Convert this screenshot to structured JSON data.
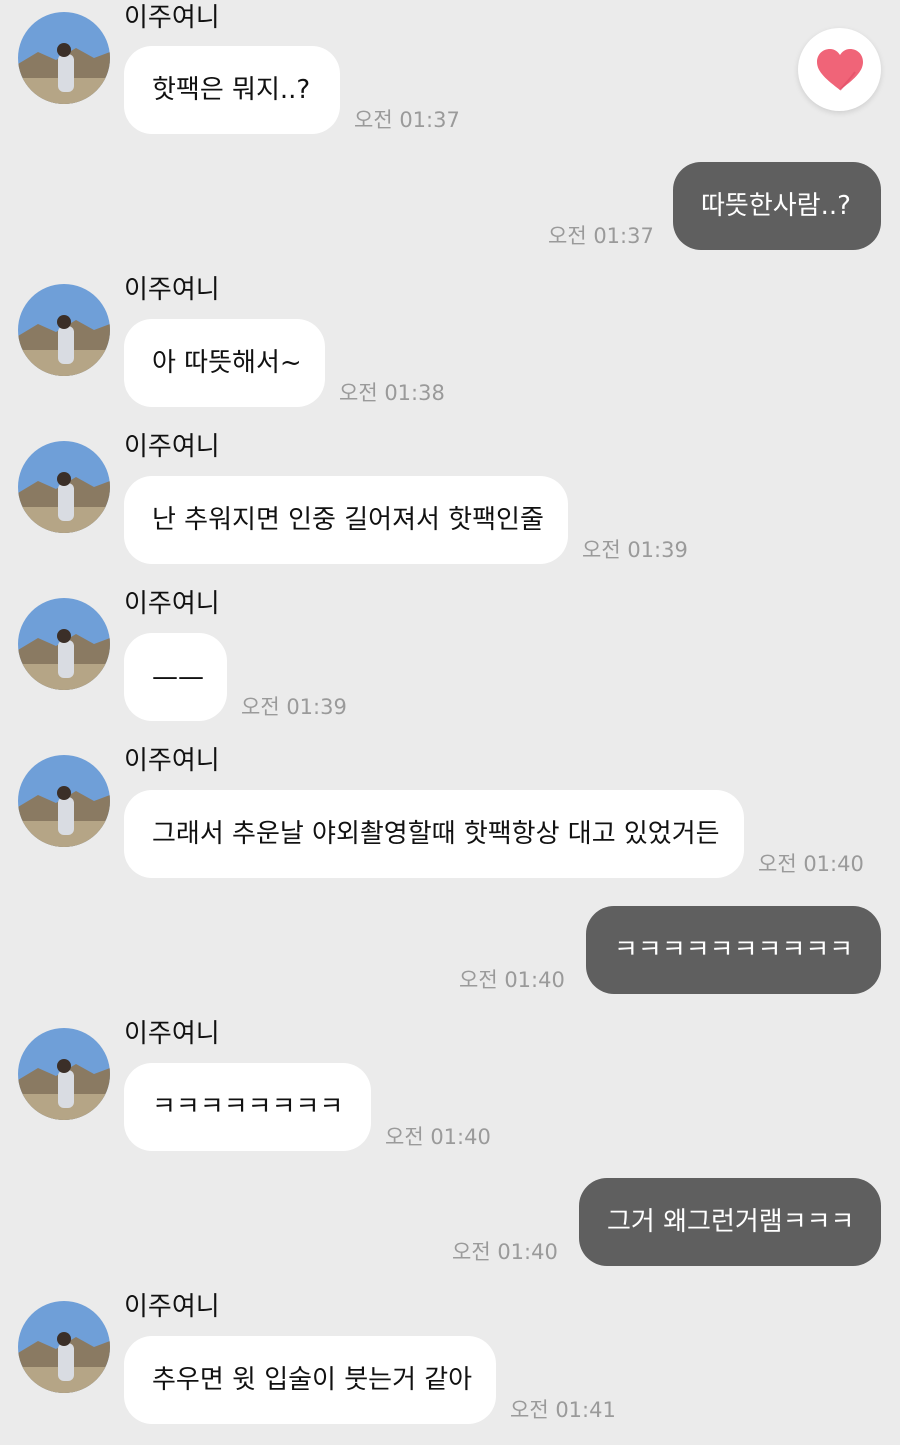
{
  "colors": {
    "background": "#ebebeb",
    "incoming_bubble": "#ffffff",
    "outgoing_bubble": "#5f5f5f",
    "timestamp": "#9a9a9a",
    "heart": "#f06478"
  },
  "reaction_button": {
    "icon": "heart-icon"
  },
  "messages": [
    {
      "sender": "이주여니",
      "text": "핫팩은 뭐지..?",
      "time": "오전 01:37"
    },
    {
      "text": "따뜻한사람..?",
      "time": "오전 01:37"
    },
    {
      "sender": "이주여니",
      "text": "아 따뜻해서~",
      "time": "오전 01:38"
    },
    {
      "sender": "이주여니",
      "text": "난 추워지면 인중 길어져서 핫팩인줄",
      "time": "오전 01:39"
    },
    {
      "sender": "이주여니",
      "text": "——",
      "time": "오전 01:39"
    },
    {
      "sender": "이주여니",
      "text": "그래서 추운날 야외촬영할때 핫팩항상 대고 있었거든",
      "time": "오전 01:40"
    },
    {
      "text": "ㅋㅋㅋㅋㅋㅋㅋㅋㅋㅋ",
      "time": "오전 01:40"
    },
    {
      "sender": "이주여니",
      "text": "ㅋㅋㅋㅋㅋㅋㅋㅋ",
      "time": "오전 01:40"
    },
    {
      "text": "그거 왜그런거램ㅋㅋㅋ",
      "time": "오전 01:40"
    },
    {
      "sender": "이주여니",
      "text": "추우면 윗 입술이 붓는거 같아",
      "time": "오전 01:41"
    }
  ]
}
